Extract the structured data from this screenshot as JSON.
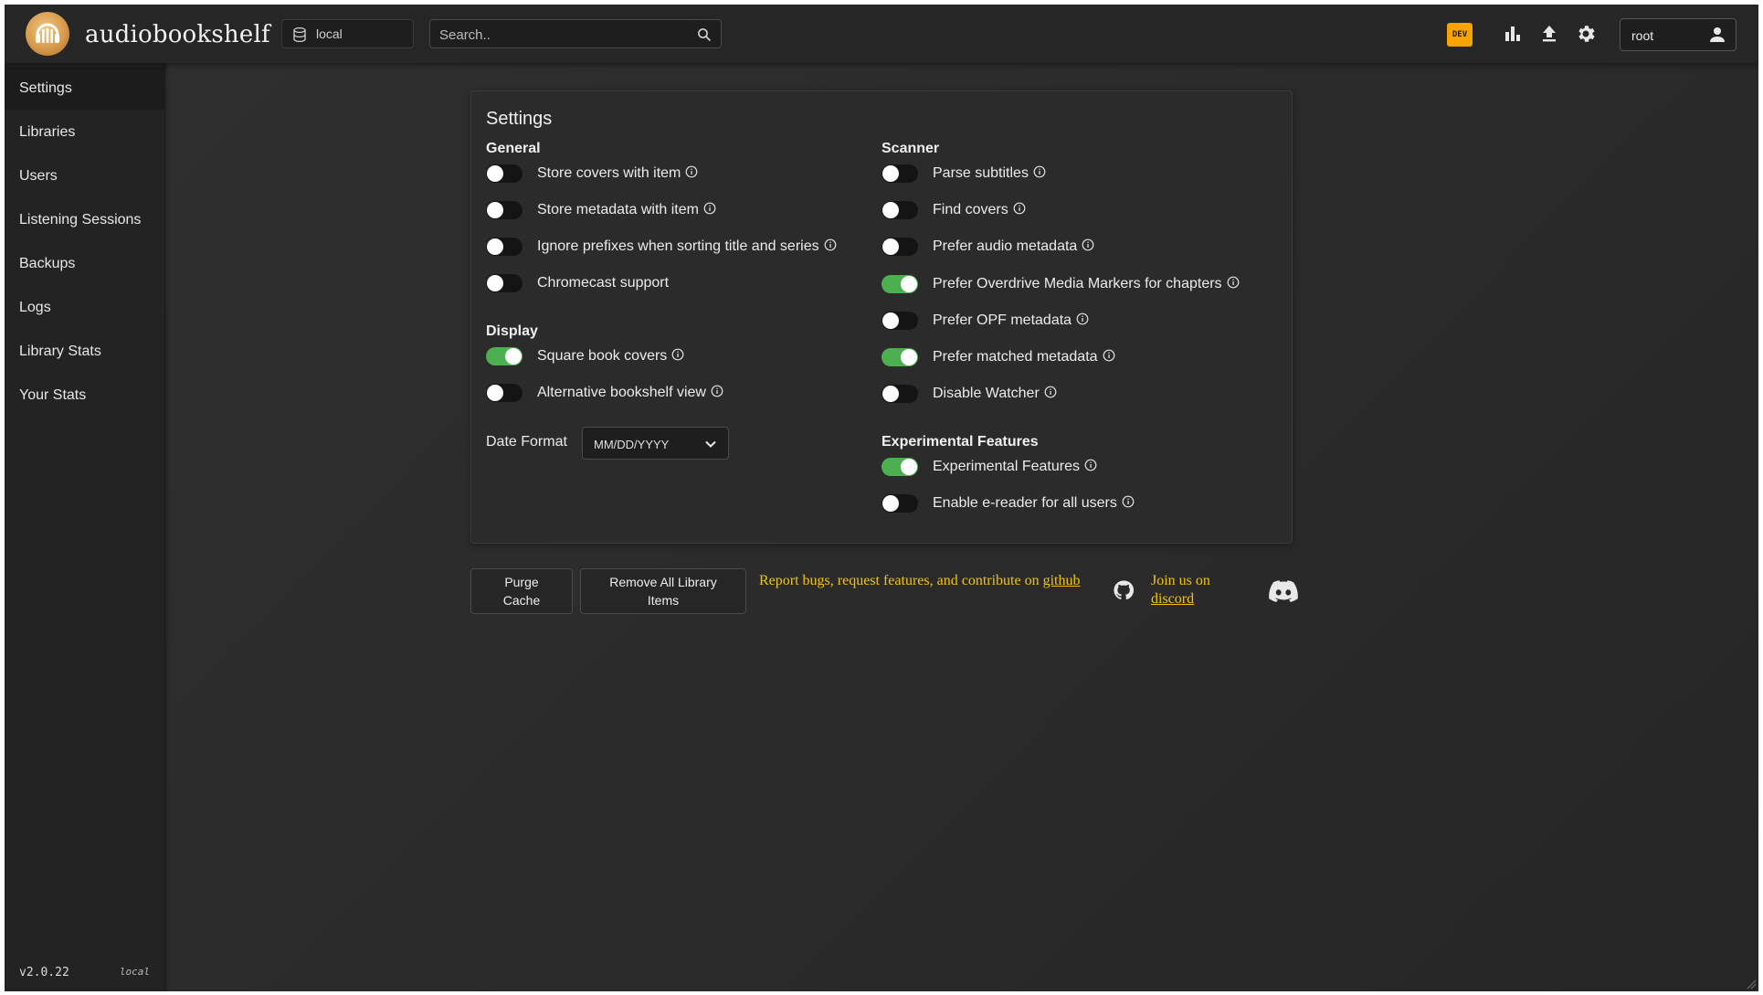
{
  "app": {
    "title": "audiobookshelf",
    "version": "v2.0.22",
    "source": "local",
    "dev_badge": "DEV"
  },
  "header": {
    "library": "local",
    "search_placeholder": "Search..",
    "user": "root",
    "icons": [
      "stats-icon",
      "upload-icon",
      "settings-gear-icon",
      "user-icon"
    ]
  },
  "sidebar": {
    "items": [
      {
        "label": "Settings",
        "active": true
      },
      {
        "label": "Libraries",
        "active": false
      },
      {
        "label": "Users",
        "active": false
      },
      {
        "label": "Listening Sessions",
        "active": false
      },
      {
        "label": "Backups",
        "active": false
      },
      {
        "label": "Logs",
        "active": false
      },
      {
        "label": "Library Stats",
        "active": false
      },
      {
        "label": "Your Stats",
        "active": false
      }
    ]
  },
  "settings": {
    "title": "Settings",
    "general": {
      "title": "General",
      "items": [
        {
          "label": "Store covers with item",
          "on": false
        },
        {
          "label": "Store metadata with item",
          "on": false
        },
        {
          "label": "Ignore prefixes when sorting title and series",
          "on": false
        },
        {
          "label": "Chromecast support",
          "on": false
        }
      ]
    },
    "display": {
      "title": "Display",
      "items": [
        {
          "label": "Square book covers",
          "on": true
        },
        {
          "label": "Alternative bookshelf view",
          "on": false
        }
      ],
      "date_format_label": "Date Format",
      "date_format_value": "MM/DD/YYYY"
    },
    "scanner": {
      "title": "Scanner",
      "items": [
        {
          "label": "Parse subtitles",
          "on": false
        },
        {
          "label": "Find covers",
          "on": false
        },
        {
          "label": "Prefer audio metadata",
          "on": false
        },
        {
          "label": "Prefer Overdrive Media Markers for chapters",
          "on": true
        },
        {
          "label": "Prefer OPF metadata",
          "on": false
        },
        {
          "label": "Prefer matched metadata",
          "on": true
        },
        {
          "label": "Disable Watcher",
          "on": false
        }
      ]
    },
    "experimental": {
      "title": "Experimental Features",
      "items": [
        {
          "label": "Experimental Features",
          "on": true
        },
        {
          "label": "Enable e-reader for all users",
          "on": false
        }
      ]
    }
  },
  "footer": {
    "purge_cache": "Purge Cache",
    "remove_items": "Remove All Library Items",
    "report_text": "Report bugs, request features, and contribute on",
    "github_link": "github",
    "join_text": "Join us on",
    "discord_link": "discord"
  },
  "colors": {
    "toggle_on": "#4caf50",
    "link": "#f1c40f",
    "dev_badge": "#f7a400"
  }
}
